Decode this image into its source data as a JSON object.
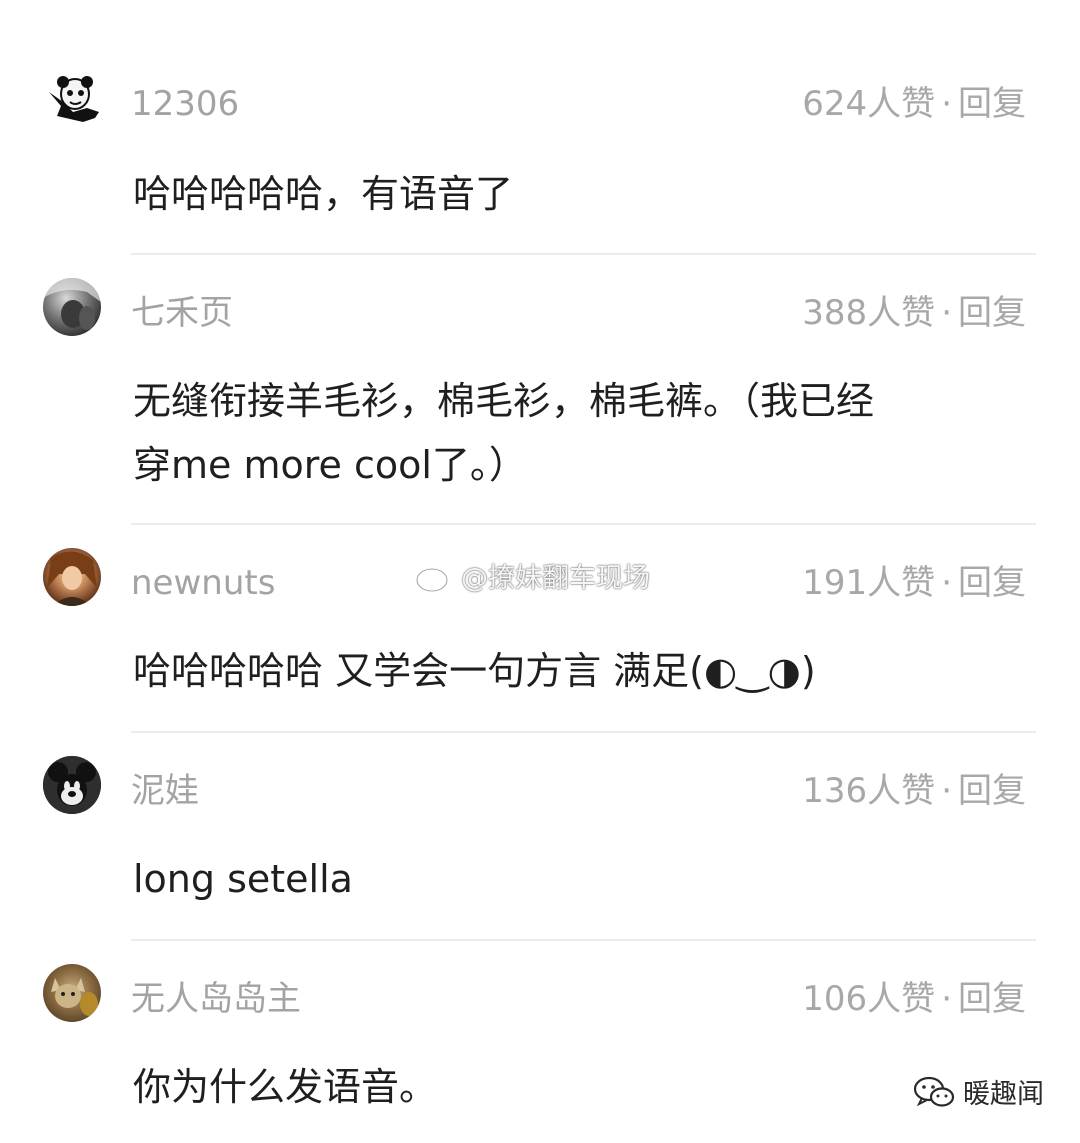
{
  "comments": [
    {
      "username": "12306",
      "likes": "624人赞",
      "reply": "回复",
      "text": "哈哈哈哈哈，有语音了",
      "avatar_icon": "panda-meme-avatar"
    },
    {
      "username": "七禾页",
      "likes": "388人赞",
      "reply": "回复",
      "text_line1": "无缝衔接羊毛衫，棉毛衫，棉毛裤。（我已经",
      "text_line2": "穿me more cool了。）",
      "avatar_icon": "photo-avatar"
    },
    {
      "username": "newnuts",
      "likes": "191人赞",
      "reply": "回复",
      "text": "哈哈哈哈哈 又学会一句方言 满足(◐‿◑)",
      "avatar_icon": "girl-photo-avatar"
    },
    {
      "username": "泥娃",
      "likes": "136人赞",
      "reply": "回复",
      "text": "long setella",
      "avatar_icon": "mickey-avatar"
    },
    {
      "username": "无人岛岛主",
      "likes": "106人赞",
      "reply": "回复",
      "text": "你为什么发语音。",
      "avatar_icon": "cat-photo-avatar"
    }
  ],
  "separator": "·",
  "watermark": "@撩妹翻车现场",
  "footer_brand": "暖趣闻",
  "colors": {
    "username": "#a3a3a3",
    "meta": "#a8a8a8",
    "text": "#1f1f1f",
    "divider": "#ececec"
  }
}
